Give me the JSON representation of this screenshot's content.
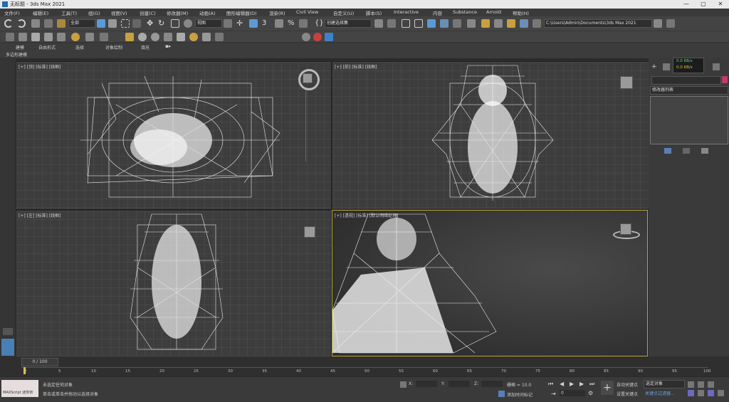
{
  "window": {
    "title": "无标题 - 3ds Max 2021",
    "min": "—",
    "max": "▢",
    "close": "✕"
  },
  "menu": [
    "文件(F)",
    "编辑(E)",
    "工具(T)",
    "组(G)",
    "视图(V)",
    "创建(C)",
    "修改器(M)",
    "动画(A)",
    "图形编辑器(D)",
    "渲染(R)",
    "Civil View",
    "自定义(U)",
    "脚本(S)",
    "Interactive",
    "内容",
    "Substance",
    "Arnold",
    "帮助(H)"
  ],
  "toolbar": {
    "selection_filter": "全部",
    "view_dropdown": "视图",
    "named_selection": "创建选择集",
    "workspace_path": "C:\\Users\\Admin\\Documents\\3ds Max 2021"
  },
  "ribbon": {
    "tabs": [
      "建模",
      "自由形式",
      "选择",
      "对象绘制",
      "填充"
    ],
    "panel_label": "多边形建模"
  },
  "viewports": [
    {
      "label": "[+] [顶] [标准] [线框]"
    },
    {
      "label": "[+] [前] [标准] [线框]"
    },
    {
      "label": "[+] [左] [标准] [线框]"
    },
    {
      "label": "[+] [透视] [标准] [默认明暗处理]"
    }
  ],
  "rightpanel": {
    "list_label": "修改器列表",
    "stat1": "0.0 KB/s",
    "stat2": "0.0 KB/s"
  },
  "timeline": {
    "frame": "0 / 100",
    "ticks": [
      "0",
      "5",
      "10",
      "15",
      "20",
      "25",
      "30",
      "35",
      "40",
      "45",
      "50",
      "55",
      "60",
      "65",
      "70",
      "75",
      "80",
      "85",
      "90",
      "95",
      "100"
    ]
  },
  "status": {
    "line1": "未选定任何对象",
    "line2": "单击或单击并拖动以选择对象",
    "maxscript": "MAXScript 迷你侦",
    "x_label": "X:",
    "y_label": "Y:",
    "z_label": "Z:",
    "grid": "栅格 = 10.0",
    "add_time_tag": "添加时间标记",
    "auto_key": "自动关键点",
    "selected": "选定对象",
    "set_key": "设置关键点",
    "key_filter": "关键点过滤器...",
    "frame_value": "0"
  },
  "colors": {
    "accent": "#5b9bd5",
    "selected_border": "#b9a23a"
  }
}
